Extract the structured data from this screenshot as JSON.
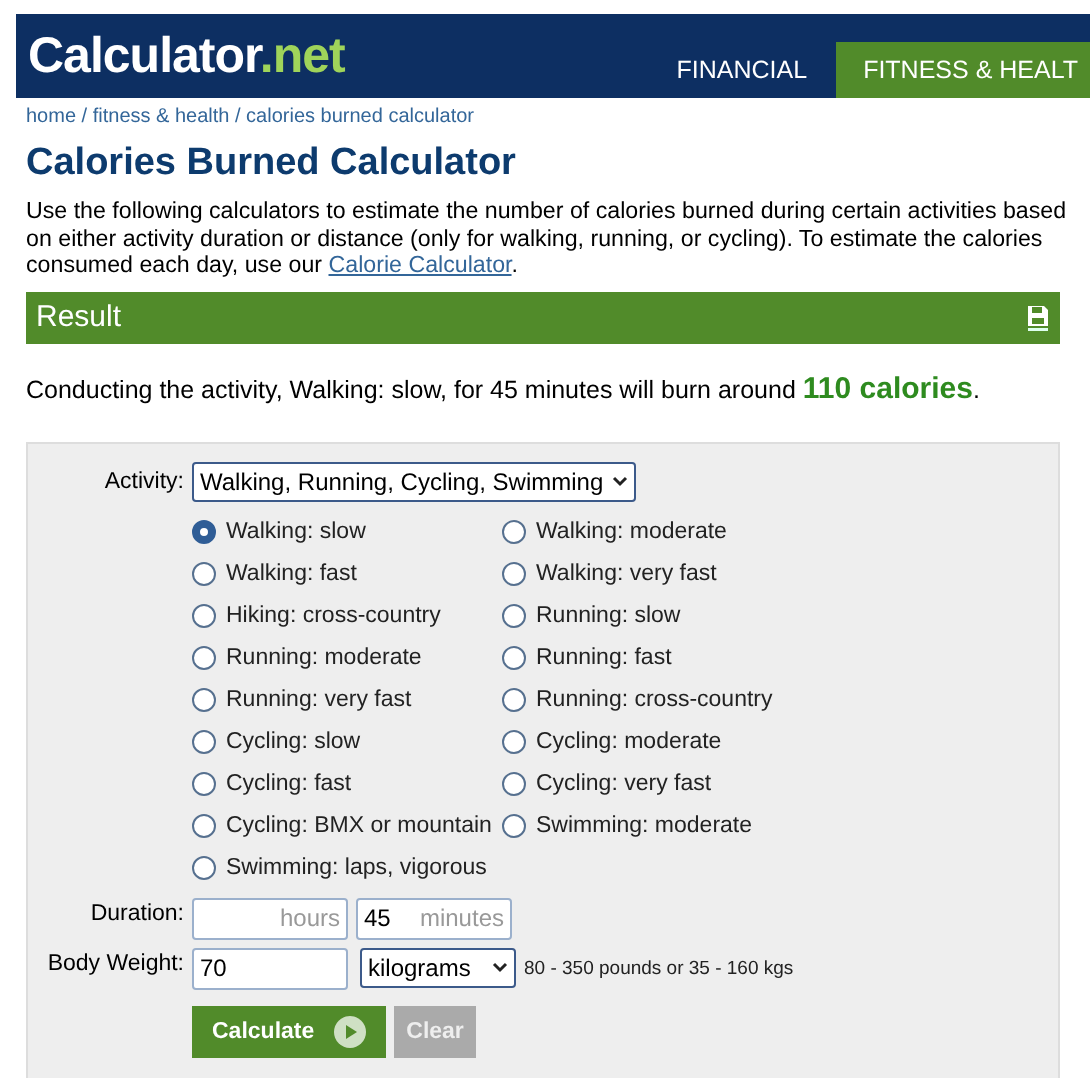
{
  "header": {
    "logo_main": "Calculator",
    "logo_accent": ".net",
    "nav": [
      {
        "label": "FINANCIAL",
        "selected": false
      },
      {
        "label": "FITNESS & HEALT",
        "selected": true
      }
    ]
  },
  "breadcrumb": "home / fitness & health / calories burned calculator",
  "title": "Calories Burned Calculator",
  "intro": {
    "text": "Use the following calculators to estimate the number of calories burned during certain activities based on either activity duration or distance (only for walking, running, or cycling). To estimate the calories consumed each day, use our ",
    "link": "Calorie Calculator",
    "after": "."
  },
  "result": {
    "heading": "Result",
    "sentence": "Conducting the activity, Walking: slow, for 45 minutes will burn around ",
    "highlight": "110 calories",
    "after": "."
  },
  "form": {
    "activity_label": "Activity:",
    "activity_value": "Walking, Running, Cycling, Swimming",
    "options": [
      {
        "label": "Walking: slow",
        "selected": true
      },
      {
        "label": "Walking: moderate",
        "selected": false
      },
      {
        "label": "Walking: fast",
        "selected": false
      },
      {
        "label": "Walking: very fast",
        "selected": false
      },
      {
        "label": "Hiking: cross-country",
        "selected": false
      },
      {
        "label": "Running: slow",
        "selected": false
      },
      {
        "label": "Running: moderate",
        "selected": false
      },
      {
        "label": "Running: fast",
        "selected": false
      },
      {
        "label": "Running: very fast",
        "selected": false
      },
      {
        "label": "Running: cross-country",
        "selected": false
      },
      {
        "label": "Cycling: slow",
        "selected": false
      },
      {
        "label": "Cycling: moderate",
        "selected": false
      },
      {
        "label": "Cycling: fast",
        "selected": false
      },
      {
        "label": "Cycling: very fast",
        "selected": false
      },
      {
        "label": "Cycling: BMX or mountain",
        "selected": false
      },
      {
        "label": "Swimming: moderate",
        "selected": false
      },
      {
        "label": "Swimming: laps, vigorous",
        "selected": false
      }
    ],
    "duration_label": "Duration:",
    "duration_fields": [
      {
        "unit": "hours"
      },
      {
        "value": "45",
        "unit": "minutes"
      }
    ],
    "weight_label": "Body Weight:",
    "weight_value": "70",
    "weight_unit": "kilograms",
    "weight_hint": "80 - 350 pounds or 35 - 160 kgs",
    "buttons": [
      {
        "kind": "primary",
        "label": "Calculate"
      },
      {
        "kind": "secondary",
        "label": "Clear"
      }
    ]
  }
}
